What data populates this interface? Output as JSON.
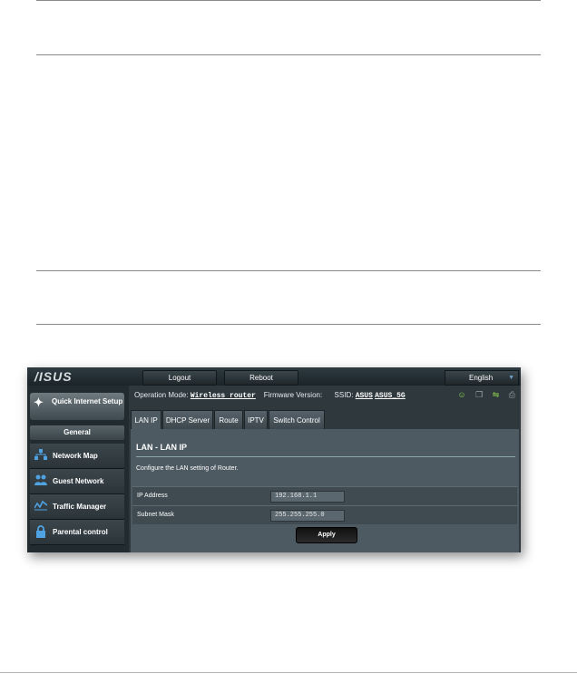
{
  "app": {
    "logo": "/ISUS"
  },
  "topbar": {
    "logout_label": "Logout",
    "reboot_label": "Reboot",
    "language": "English"
  },
  "sidebar": {
    "quick_setup_label": "Quick Internet Setup",
    "section_label": "General",
    "items": [
      {
        "label": "Network Map",
        "icon": "network-map-icon"
      },
      {
        "label": "Guest Network",
        "icon": "guest-network-icon"
      },
      {
        "label": "Traffic Manager",
        "icon": "traffic-manager-icon"
      },
      {
        "label": "Parental control",
        "icon": "lock-icon"
      }
    ]
  },
  "status": {
    "op_mode_label": "Operation Mode:",
    "op_mode_value": "Wireless router",
    "firmware_label": "Firmware Version:",
    "ssid_label": "SSID:",
    "ssid_values": [
      "ASUS",
      "ASUS_5G"
    ],
    "icons": [
      "user-icon",
      "copy-icon",
      "usb-icon",
      "printer-icon"
    ]
  },
  "tabs": [
    "LAN IP",
    "DHCP Server",
    "Route",
    "IPTV",
    "Switch Control"
  ],
  "panel": {
    "title": "LAN - LAN IP",
    "description": "Configure the LAN setting of Router.",
    "fields": [
      {
        "label": "IP Address",
        "value": "192.168.1.1"
      },
      {
        "label": "Subnet Mask",
        "value": "255.255.255.0"
      }
    ],
    "apply_label": "Apply"
  },
  "colors": {
    "accent_green": "#8fd14f",
    "icon_blue": "#4fa3e3",
    "panel_bg": "#4d5a61"
  }
}
